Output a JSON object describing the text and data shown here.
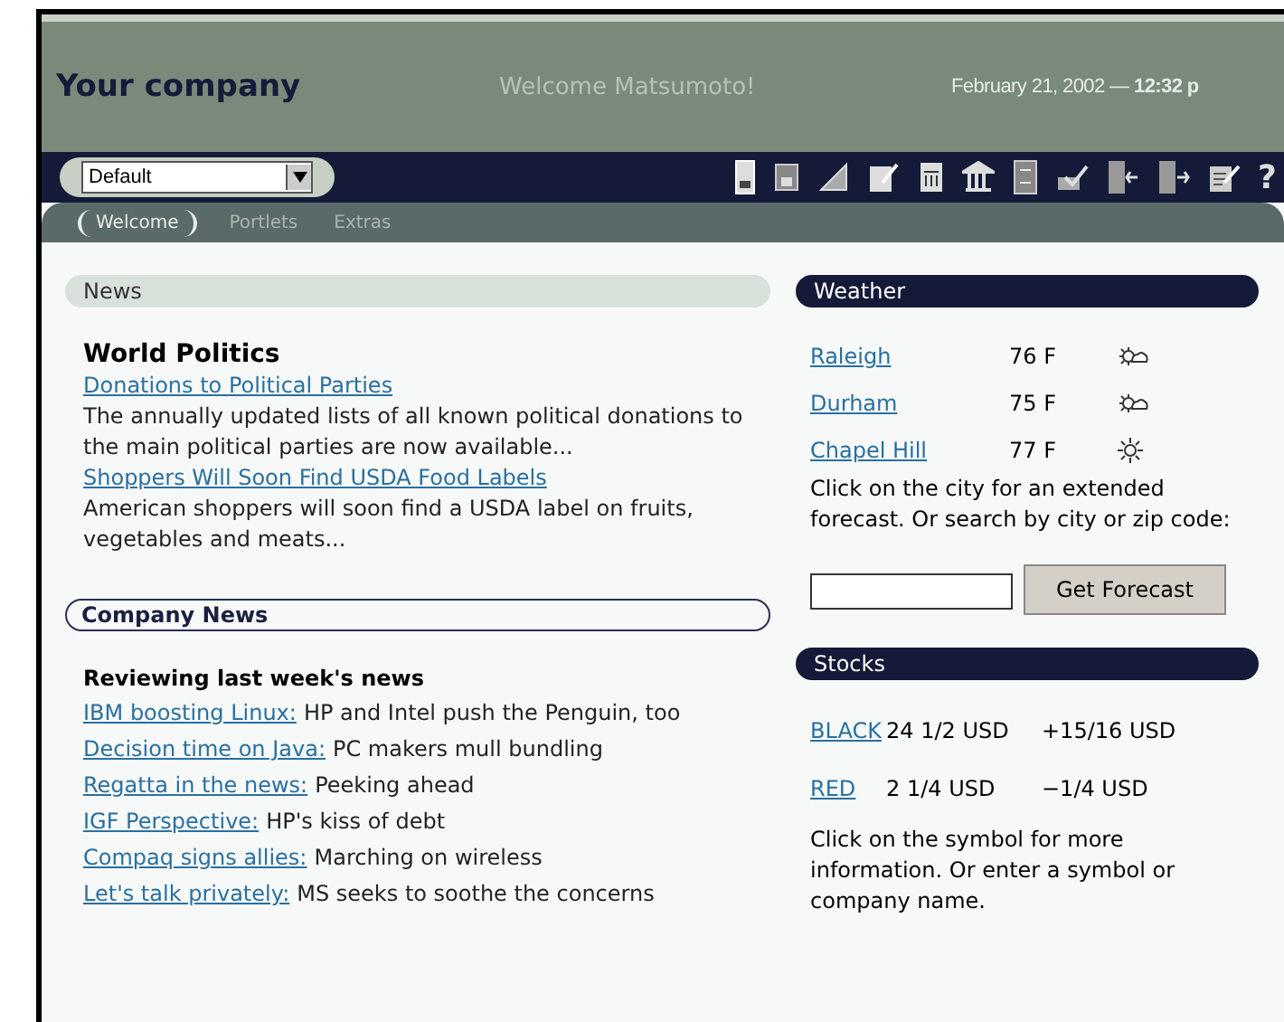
{
  "header": {
    "company": "Your company",
    "welcome": "Welcome Matsumoto!",
    "datetime": "February 21, 2002 — **12:32 p**"
  },
  "toolbar": {
    "dropdown": "Default",
    "help": "?"
  },
  "tabs": [
    {
      "label": "Welcome",
      "selected": true
    },
    {
      "label": "Portlets",
      "selected": false
    },
    {
      "label": "Extras",
      "selected": false
    }
  ],
  "news": {
    "title": "News",
    "heading": "World Politics",
    "items": [
      {
        "link": "Donations to Political Parties",
        "text": "The annually updated lists of all known political donations to the main political parties are now available..."
      },
      {
        "link": "Shoppers Will Soon Find USDA Food Labels",
        "text": "American shoppers will soon find a USDA label on fruits, vegetables and meats..."
      }
    ]
  },
  "company_news": {
    "title": "Company News",
    "heading": "Reviewing last week's news",
    "items": [
      {
        "link": "IBM boosting Linux:",
        "text": "HP and Intel push the Penguin, too"
      },
      {
        "link": "Decision time on Java:",
        "text": "PC makers mull bundling"
      },
      {
        "link": "Regatta in the news:",
        "text": "Peeking ahead"
      },
      {
        "link": "IGF Perspective:",
        "text": "HP's kiss of debt"
      },
      {
        "link": "Compaq signs allies:",
        "text": "Marching on wireless"
      },
      {
        "link": "Let's talk privately:",
        "text": "MS seeks to soothe the concerns"
      }
    ]
  },
  "weather": {
    "title": "Weather",
    "cities": [
      {
        "name": "Raleigh",
        "temp": "76 F",
        "kind": "partly-cloudy"
      },
      {
        "name": "Durham",
        "temp": "75 F",
        "kind": "partly-cloudy"
      },
      {
        "name": "Chapel Hill",
        "temp": "77 F",
        "kind": "sunny"
      }
    ],
    "note": "Click on the city for an extended forecast. Or search by city or zip code:",
    "button": "Get Forecast"
  },
  "stocks": {
    "title": "Stocks",
    "rows": [
      {
        "symbol": "BLACK",
        "price": "24 1/2 USD",
        "change": "+15/16 USD"
      },
      {
        "symbol": "RED",
        "price": "2 1/4 USD",
        "change": "−1/4 USD"
      }
    ],
    "note": "Click on the symbol for more information. Or enter a symbol or company name."
  }
}
